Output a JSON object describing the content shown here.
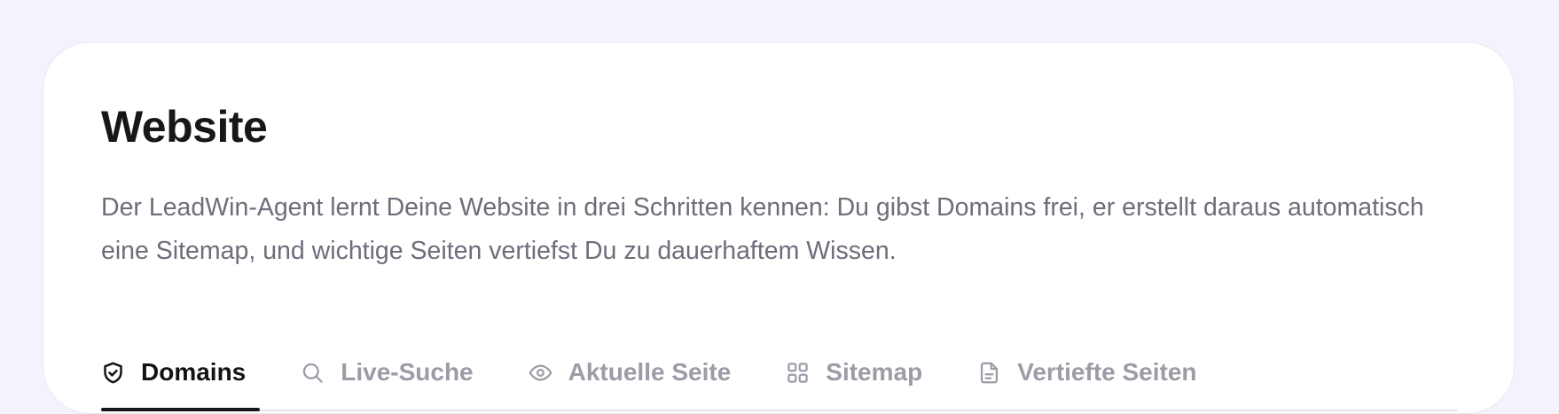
{
  "header": {
    "title": "Website",
    "description": "Der LeadWin-Agent lernt Deine Website in drei Schritten kennen: Du gibst Domains frei, er erstellt daraus automatisch eine Sitemap, und wichtige Seiten vertiefst Du zu dauerhaftem Wissen."
  },
  "tabs": [
    {
      "label": "Domains",
      "icon": "shield-check-icon",
      "active": true
    },
    {
      "label": "Live-Suche",
      "icon": "search-icon",
      "active": false
    },
    {
      "label": "Aktuelle Seite",
      "icon": "eye-icon",
      "active": false
    },
    {
      "label": "Sitemap",
      "icon": "grid-icon",
      "active": false
    },
    {
      "label": "Vertiefte Seiten",
      "icon": "document-icon",
      "active": false
    }
  ],
  "colors": {
    "page_background": "#f4f3fd",
    "card_background": "#ffffff",
    "active_tab": "#131316",
    "inactive_tab": "#9b9ca6"
  }
}
